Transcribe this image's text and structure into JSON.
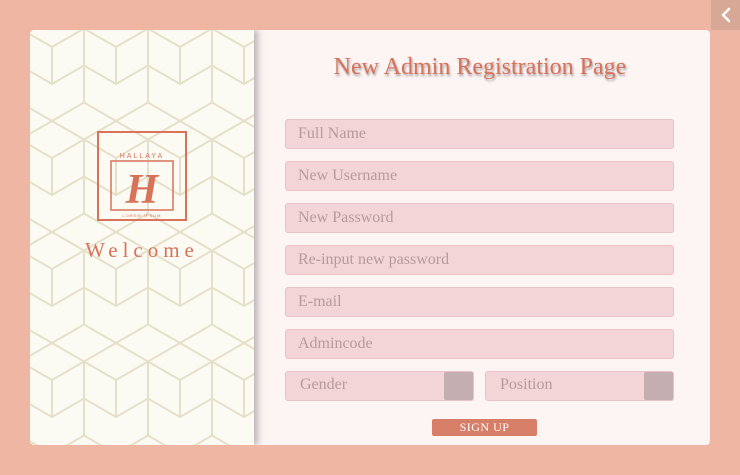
{
  "nav": {
    "back_icon": "chevron-left-icon"
  },
  "brand": {
    "logo_text": "HALLAYA",
    "logo_monogram": "H",
    "logo_subtext": "LOREM IPSUM",
    "welcome": "Welcome"
  },
  "form": {
    "title": "New Admin Registration Page",
    "fields": {
      "full_name": "Full Name",
      "username": "New Username",
      "password": "New Password",
      "confirm_password": "Re-input new password",
      "email": "E-mail",
      "admincode": "Admincode"
    },
    "gender": "Gender",
    "position": "Position",
    "submit_label": "SIGN UP"
  },
  "colors": {
    "background": "#efb6a3",
    "accent": "#d8735a",
    "field_bg": "#f3d5d8",
    "button": "#d67e68"
  }
}
